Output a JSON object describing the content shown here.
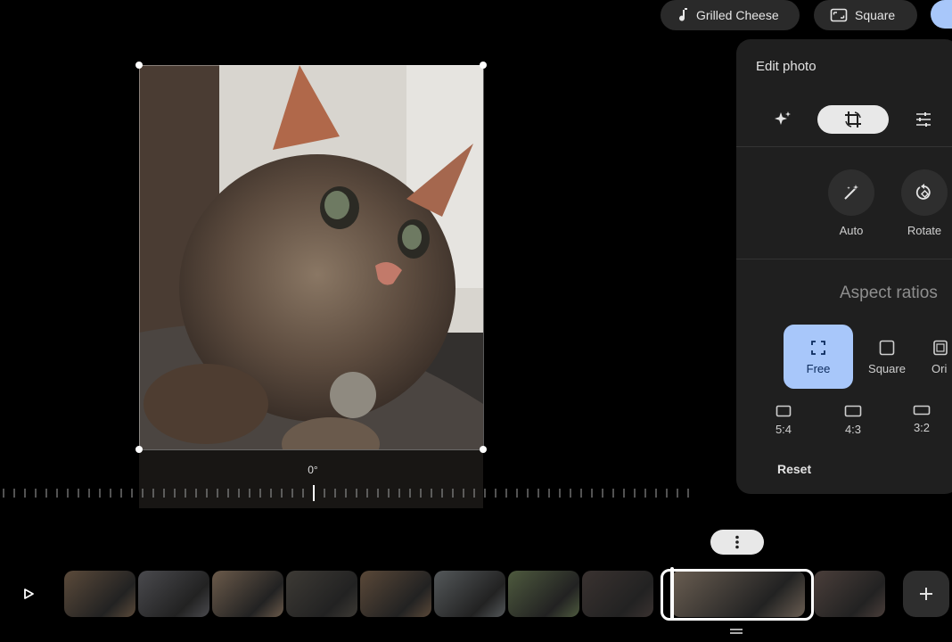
{
  "top_chips": {
    "music_label": "Grilled Cheese",
    "aspect_label": "Square"
  },
  "editor": {
    "angle_label": "0°"
  },
  "edit_panel": {
    "title": "Edit photo",
    "tools": [
      {
        "name": "sparkle-icon"
      },
      {
        "name": "crop-rotate-icon",
        "active": true
      },
      {
        "name": "adjust-sliders-icon"
      }
    ],
    "actions": {
      "auto_label": "Auto",
      "rotate_label": "Rotate"
    },
    "aspect_title": "Aspect ratios",
    "ratios": {
      "free": "Free",
      "square": "Square",
      "original": "Ori",
      "r54": "5:4",
      "r43": "4:3",
      "r32": "3:2"
    },
    "reset_label": "Reset"
  },
  "timeline": {
    "thumb_colors": [
      "#5b4a3a",
      "#4a4a4e",
      "#6b5a4a",
      "#3d3a35",
      "#5a4838",
      "#54585a",
      "#4e5a3e",
      "#3a3230",
      "#6a5e52",
      "#4a3e3a"
    ]
  },
  "colors": {
    "accent": "#a8c7fa",
    "panel_bg": "#1f1f1f"
  }
}
